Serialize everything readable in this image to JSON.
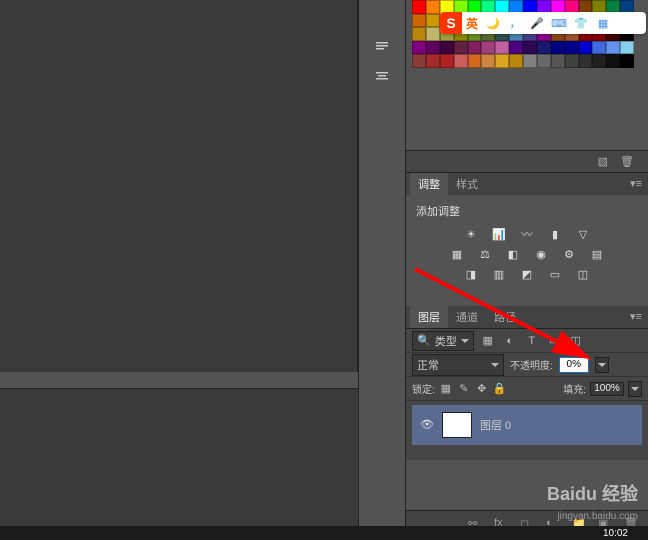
{
  "ime": {
    "logo": "S",
    "lang": "英"
  },
  "adjust_panel": {
    "tabs": [
      "调整",
      "样式"
    ],
    "active_tab": "调整",
    "title": "添加调整"
  },
  "layers_panel": {
    "tabs": [
      "图层",
      "通道",
      "路径"
    ],
    "active_tab": "图层",
    "type_label": "类型",
    "blend_mode": "正常",
    "opacity_label": "不透明度:",
    "opacity_value": "0%",
    "lock_label": "锁定:",
    "fill_label": "填充:",
    "fill_value": "100%",
    "layer": {
      "name": "图层 0"
    }
  },
  "watermark": {
    "brand": "Baidu 经验",
    "url": "jingyan.baidu.com"
  },
  "taskbar": {
    "time": "10:02"
  },
  "swatch_colors": [
    "#ff0000",
    "#ff8000",
    "#ffff00",
    "#80ff00",
    "#00ff00",
    "#00ff80",
    "#00ffff",
    "#0080ff",
    "#0000ff",
    "#8000ff",
    "#ff00ff",
    "#ff0080",
    "#804000",
    "#808000",
    "#008040",
    "#004080",
    "#cc6600",
    "#cc9900",
    "#cccc00",
    "#99cc00",
    "#66cc00",
    "#00cc66",
    "#00cccc",
    "#0099cc",
    "#0066cc",
    "#6600cc",
    "#cc00cc",
    "#cc0066",
    "#663300",
    "#666600",
    "#006633",
    "#003366",
    "#b8860b",
    "#bdb76b",
    "#a0a040",
    "#8b8b00",
    "#6b8e23",
    "#556b2f",
    "#2f4f4f",
    "#4682b4",
    "#483d8b",
    "#8b008b",
    "#8b4513",
    "#a0522d",
    "#8b0000",
    "#800000",
    "#400000",
    "#000000",
    "#800080",
    "#600060",
    "#400040",
    "#602040",
    "#802060",
    "#a04080",
    "#c060a0",
    "#4b0082",
    "#2e0854",
    "#191970",
    "#000080",
    "#00008b",
    "#0000cd",
    "#4169e1",
    "#6495ed",
    "#87ceeb",
    "#8b3a3a",
    "#a52a2a",
    "#b22222",
    "#cd5c5c",
    "#d2691e",
    "#cd853f",
    "#daa520",
    "#b8860b",
    "#808080",
    "#696969",
    "#555555",
    "#404040",
    "#303030",
    "#202020",
    "#101010",
    "#000000"
  ]
}
